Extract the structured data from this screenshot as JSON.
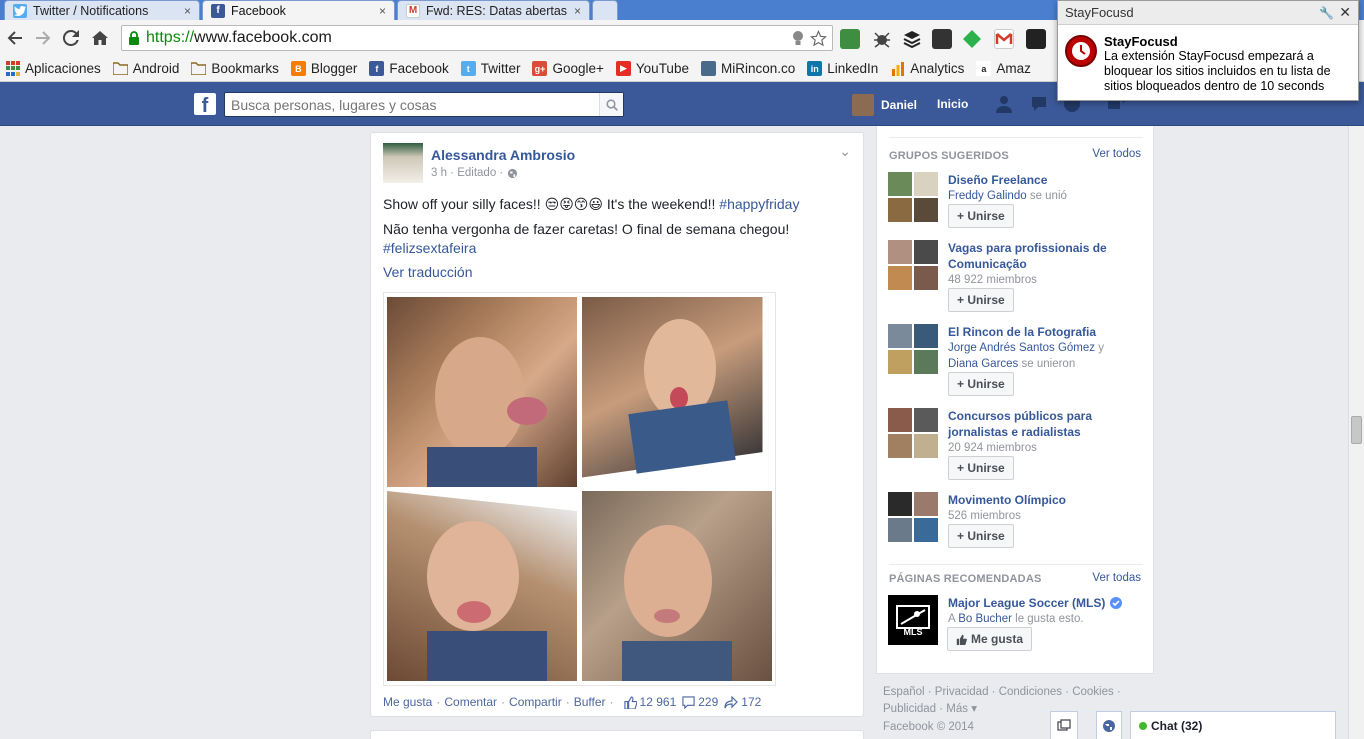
{
  "browser": {
    "tabs": [
      {
        "title": "Twitter / Notifications",
        "icon": "twitter-bird-icon",
        "active": false
      },
      {
        "title": "Facebook",
        "icon": "facebook-f-icon",
        "active": true
      },
      {
        "title": "Fwd: RES: Datas abertas -",
        "icon": "gmail-icon",
        "active": false
      }
    ],
    "tab_close": "×",
    "url_scheme": "https://",
    "url_host": "www.facebook.com",
    "bookmarks": [
      {
        "label": "Aplicaciones",
        "icon": "apps-grid-icon",
        "color": "#d23c2a"
      },
      {
        "label": "Android",
        "icon": "folder-icon",
        "color": "#e2b33c"
      },
      {
        "label": "Bookmarks",
        "icon": "folder-icon",
        "color": "#e2b33c"
      },
      {
        "label": "Blogger",
        "icon": "blogger-icon",
        "color": "#f57d00"
      },
      {
        "label": "Facebook",
        "icon": "facebook-icon",
        "color": "#3b5998"
      },
      {
        "label": "Twitter",
        "icon": "twitter-icon",
        "color": "#55acee"
      },
      {
        "label": "Google+",
        "icon": "google-plus-icon",
        "color": "#dd4b39"
      },
      {
        "label": "YouTube",
        "icon": "youtube-icon",
        "color": "#e52d27"
      },
      {
        "label": "MiRincon.co",
        "icon": "avatar-icon",
        "color": "#4a6a8a"
      },
      {
        "label": "LinkedIn",
        "icon": "linkedin-icon",
        "color": "#0e76a8"
      },
      {
        "label": "Analytics",
        "icon": "analytics-icon",
        "color": "#e37400"
      },
      {
        "label": "Amaz",
        "icon": "amazon-icon",
        "color": "#222222"
      }
    ]
  },
  "notification": {
    "window_title": "StayFocusd",
    "title": "StayFocusd",
    "body": "La extensión StayFocusd empezará a bloquear los sitios incluidos en tu lista de sitios bloqueados dentro de 10 seconds"
  },
  "facebook": {
    "search_placeholder": "Busca personas, lugares y cosas",
    "user_name": "Daniel",
    "home_label": "Inicio"
  },
  "post": {
    "author": "Alessandra Ambrosio",
    "meta": "3 h · Editado ·",
    "line1_text": "Show off your silly faces!!",
    "line1_emoji": "😒😝😙😃",
    "line1_rest": "It's the weekend!!",
    "line1_hashtag": "#happyfriday",
    "line2": "Não tenha vergonha de fazer caretas! O final de semana chegou!",
    "line3_hashtag": "#felizsextafeira",
    "translate": "Ver traducción",
    "actions": [
      "Me gusta",
      "Comentar",
      "Compartir",
      "Buffer"
    ],
    "likes": "12 961",
    "comments": "229",
    "shares": "172"
  },
  "sidebar": {
    "groups_heading": "GRUPOS SUGERIDOS",
    "groups_see_all": "Ver todos",
    "join_label": "+ Unirse",
    "groups": [
      {
        "name": "Diseño Freelance",
        "sub_link": "Freddy Galindo",
        "sub_text": " se unió"
      },
      {
        "name": "Vagas para profissionais de Comunicação",
        "sub_text": "48 922 miembros"
      },
      {
        "name": "El Rincon de la Fotografia",
        "sub_link": "Jorge Andrés Santos Gómez",
        "sub_text": " y ",
        "sub_link2": "Diana Garces",
        "sub_text2": " se unieron"
      },
      {
        "name": "Concursos públicos para jornalistas e radialistas",
        "sub_text": "20 924 miembros"
      },
      {
        "name": "Movimento Olímpico",
        "sub_text": "526 miembros"
      }
    ],
    "pages_heading": "PÁGINAS RECOMENDADAS",
    "pages_see_all": "Ver todas",
    "page_name": "Major League Soccer (MLS)",
    "page_sub_prefix": "A ",
    "page_sub_link": "Bo Bucher",
    "page_sub_suffix": " le gusta esto.",
    "page_like": "Me gusta",
    "page_logo_text": "MLS"
  },
  "footer": {
    "line1": "Español · Privacidad · Condiciones · Cookies ·",
    "line2": "Publicidad · Más ▾",
    "copyright": "Facebook © 2014"
  },
  "chat": {
    "label": "Chat (32)"
  }
}
